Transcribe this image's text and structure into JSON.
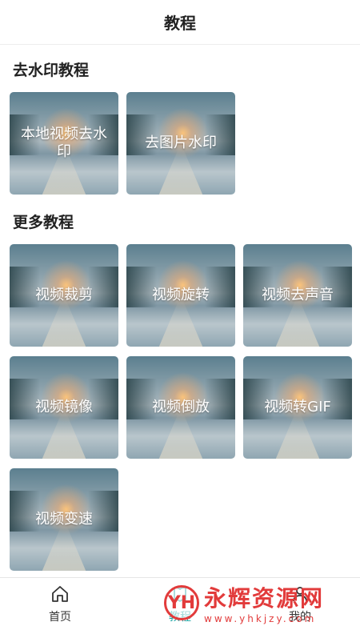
{
  "header": {
    "title": "教程"
  },
  "sections": [
    {
      "title": "去水印教程",
      "cards": [
        {
          "label": "本地视频去水印"
        },
        {
          "label": "去图片水印"
        }
      ]
    },
    {
      "title": "更多教程",
      "cards": [
        {
          "label": "视频裁剪"
        },
        {
          "label": "视频旋转"
        },
        {
          "label": "视频去声音"
        },
        {
          "label": "视频镜像"
        },
        {
          "label": "视频倒放"
        },
        {
          "label": "视频转GIF"
        },
        {
          "label": "视频变速"
        }
      ]
    }
  ],
  "bottom_nav": [
    {
      "label": "首页",
      "icon": "home-icon",
      "active": false
    },
    {
      "label": "教程",
      "icon": "tutorial-icon",
      "active": true
    },
    {
      "label": "我的",
      "icon": "user-icon",
      "active": false
    }
  ],
  "watermark": {
    "logo": "YH",
    "text": "永辉资源网",
    "url": "www.yhkjzy.com"
  },
  "colors": {
    "accent": "#1aa3a3",
    "watermark": "#e23b3b"
  }
}
